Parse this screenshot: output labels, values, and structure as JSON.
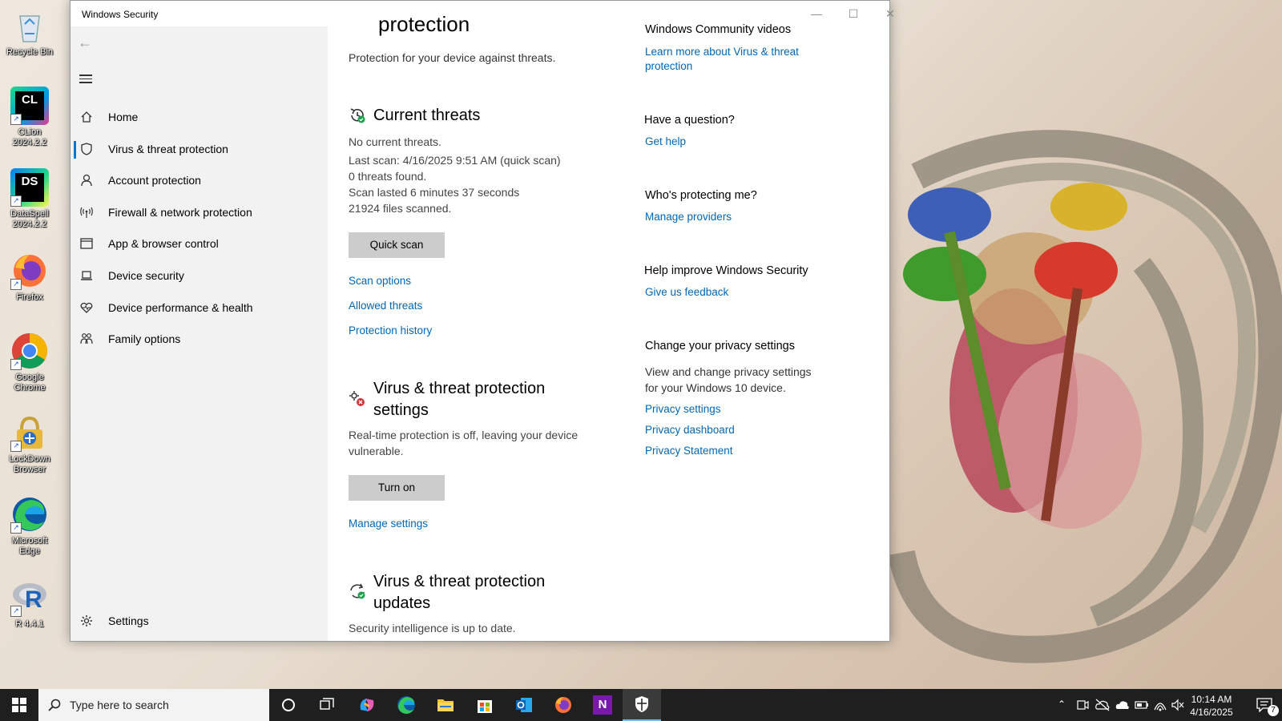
{
  "window": {
    "title": "Windows Security",
    "controls": {
      "minimize": "—",
      "maximize": "☐",
      "close": "✕"
    }
  },
  "sidebar": {
    "items": [
      {
        "label": "Home",
        "icon": "home-icon"
      },
      {
        "label": "Virus & threat protection",
        "icon": "shield-icon",
        "active": true
      },
      {
        "label": "Account protection",
        "icon": "person-icon"
      },
      {
        "label": "Firewall & network protection",
        "icon": "antenna-icon"
      },
      {
        "label": "App & browser control",
        "icon": "browser-window-icon"
      },
      {
        "label": "Device security",
        "icon": "laptop-icon"
      },
      {
        "label": "Device performance & health",
        "icon": "heart-icon"
      },
      {
        "label": "Family options",
        "icon": "family-icon"
      }
    ],
    "settings_label": "Settings"
  },
  "main": {
    "page_heading_partial": "protection",
    "page_subtitle": "Protection for your device against threats.",
    "current_threats": {
      "heading": "Current threats",
      "status": "No current threats.",
      "last_scan": "Last scan: 4/16/2025 9:51 AM (quick scan)",
      "threats_found": "0 threats found.",
      "duration": "Scan lasted 6 minutes 37 seconds",
      "files_scanned": "21924 files scanned.",
      "quick_scan_button": "Quick scan",
      "links": [
        "Scan options",
        "Allowed threats",
        "Protection history"
      ]
    },
    "settings_section": {
      "heading_line1": "Virus & threat protection",
      "heading_line2": "settings",
      "desc_line1": "Real-time protection is off, leaving your device",
      "desc_line2": "vulnerable.",
      "turn_on_button": "Turn on",
      "manage_link": "Manage settings"
    },
    "updates_section": {
      "heading_line1": "Virus & threat protection",
      "heading_line2": "updates",
      "status": "Security intelligence is up to date."
    }
  },
  "right_panel": {
    "community_heading": "Windows Community videos",
    "community_link_line1": "Learn more about Virus & threat",
    "community_link_line2": "protection",
    "question_heading": "Have a question?",
    "get_help_link": "Get help",
    "protecting_heading": "Who's protecting me?",
    "manage_providers_link": "Manage providers",
    "improve_heading": "Help improve Windows Security",
    "feedback_link": "Give us feedback",
    "privacy_heading": "Change your privacy settings",
    "privacy_desc_line1": "View and change privacy settings",
    "privacy_desc_line2": "for your Windows 10 device.",
    "privacy_links": [
      "Privacy settings",
      "Privacy dashboard",
      "Privacy Statement"
    ]
  },
  "desktop": {
    "icons": [
      {
        "label": "Recycle Bin",
        "icon": "recycle-bin-icon"
      },
      {
        "label": "CLion 2024.2.2",
        "icon": "clion-icon"
      },
      {
        "label": "DataSpell 2024.2.2",
        "icon": "dataspell-icon"
      },
      {
        "label": "Firefox",
        "icon": "firefox-icon"
      },
      {
        "label": "Google Chrome",
        "icon": "chrome-icon"
      },
      {
        "label": "LockDown Browser",
        "icon": "lockdown-browser-icon"
      },
      {
        "label": "Microsoft Edge",
        "icon": "edge-icon"
      },
      {
        "label": "R 4.4.1",
        "icon": "r-icon"
      }
    ],
    "clion_badge": "CL",
    "dataspell_badge": "DS",
    "r_badge": "R"
  },
  "taskbar": {
    "search_placeholder": "Type here to search",
    "time": "10:14 AM",
    "date": "4/16/2025",
    "notification_count": "7",
    "onenote_letter": "N"
  },
  "colors": {
    "accent": "#0078d4",
    "link": "#0067b8",
    "sidebar_bg": "#f2f2f2",
    "taskbar_bg": "#1f1f1f"
  }
}
